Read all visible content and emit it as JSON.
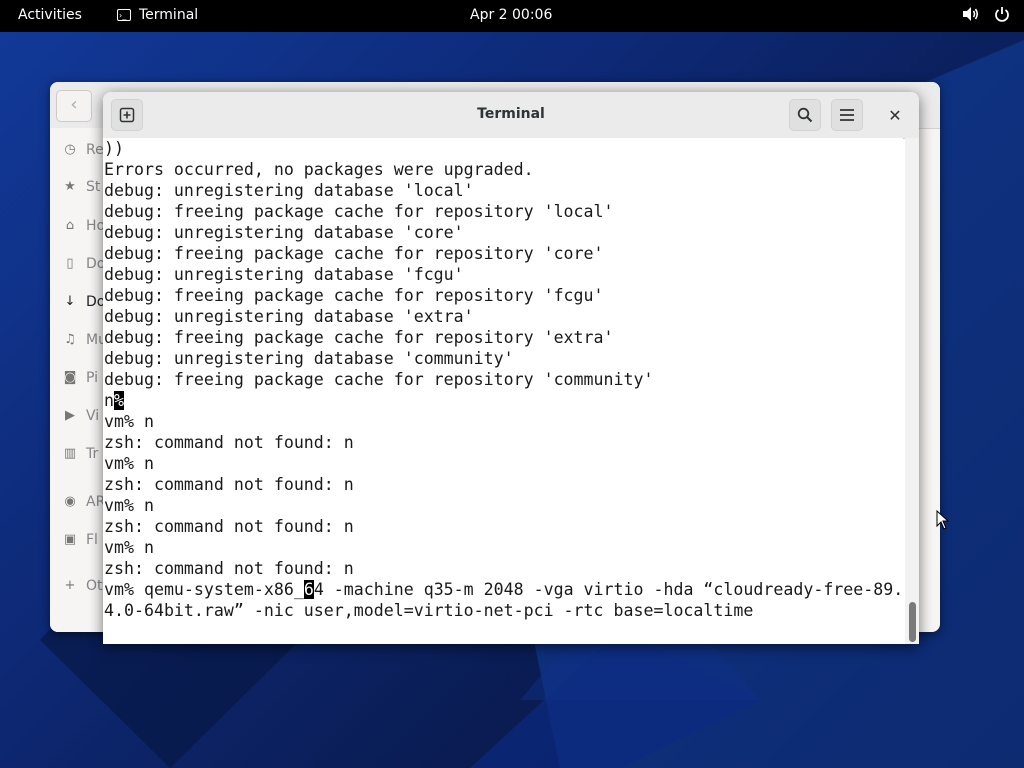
{
  "topbar": {
    "activities": "Activities",
    "app_name": "Terminal",
    "clock": "Apr 2  00:06",
    "icons": [
      "speaker-icon",
      "power-icon"
    ]
  },
  "files_window": {
    "sidebar_items": [
      {
        "icon": "clock-icon",
        "label": "Re"
      },
      {
        "icon": "star-icon",
        "label": "St"
      },
      {
        "icon": "home-icon",
        "label": "Ho"
      },
      {
        "icon": "document-icon",
        "label": "Do"
      },
      {
        "icon": "download-icon",
        "label": "Do"
      },
      {
        "icon": "music-icon",
        "label": "Mu"
      },
      {
        "icon": "camera-icon",
        "label": "Pi"
      },
      {
        "icon": "video-icon",
        "label": "Vi"
      },
      {
        "icon": "trash-icon",
        "label": "Tr"
      },
      {
        "icon": "disc-icon",
        "label": "AR"
      },
      {
        "icon": "drive-icon",
        "label": "Fl"
      },
      {
        "icon": "plus-icon",
        "label": "Ot"
      }
    ]
  },
  "terminal": {
    "title": "Terminal",
    "lines": [
      "))",
      "Errors occurred, no packages were upgraded.",
      "debug: unregistering database 'local'",
      "debug: freeing package cache for repository 'local'",
      "debug: unregistering database 'core'",
      "debug: freeing package cache for repository 'core'",
      "debug: unregistering database 'fcgu'",
      "debug: freeing package cache for repository 'fcgu'",
      "debug: unregistering database 'extra'",
      "debug: freeing package cache for repository 'extra'",
      "debug: unregistering database 'community'",
      "debug: freeing package cache for repository 'community'",
      "n",
      "vm% n",
      "zsh: command not found: n",
      "vm% n",
      "zsh: command not found: n",
      "vm% n",
      "zsh: command not found: n",
      "vm% n",
      "zsh: command not found: n",
      "vm% qemu-system-x86_",
      "4.0-64bit.raw” -nic user,model=virtio-net-pci -rtc base=localtime"
    ],
    "line12_cursor_char": "%",
    "line21_cursor_char": "6",
    "line21_rest": "4 -machine q35-m 2048 -vga virtio -hda “cloudready-free-89."
  },
  "colors": {
    "topbar_bg": "#000000",
    "terminal_bg": "#ffffff",
    "terminal_text": "#1a1a1a",
    "desktop_blue": "#123a9a"
  }
}
